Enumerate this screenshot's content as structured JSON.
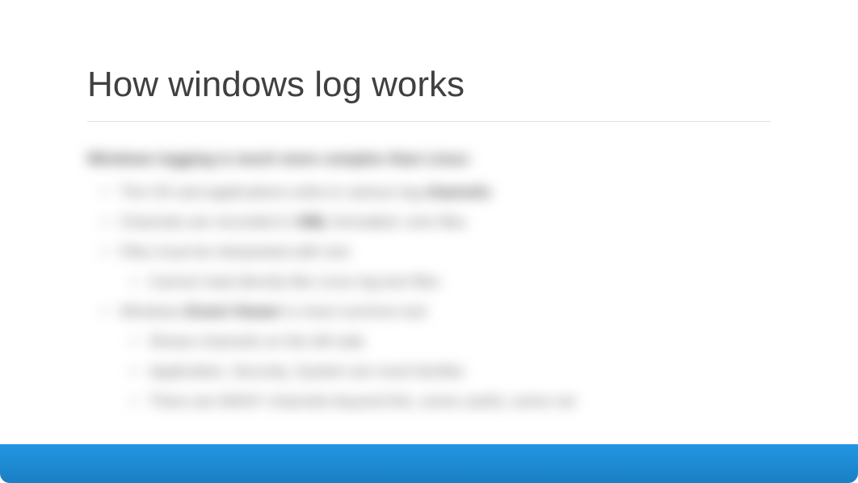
{
  "slide": {
    "title": "How windows log works",
    "intro": "Windows logging is much more complex than Linux:",
    "bullets": [
      {
        "text_prefix": "The OS and applications write to various log ",
        "bold": "channels",
        "text_suffix": ""
      },
      {
        "text_prefix": "Channels are recorded in ",
        "bold": "XML",
        "text_suffix": " formatted .evtx files"
      },
      {
        "text_prefix": "Files must be interpreted with tool",
        "bold": "",
        "text_suffix": "",
        "sub": [
          "Cannot read directly like Linux log text files"
        ]
      },
      {
        "text_prefix": "Windows ",
        "bold": "Event Viewer",
        "text_suffix": " is most common tool",
        "sub": [
          "Shows channels on the left side",
          "Application, Security, System are most familiar",
          "There are MANY channels beyond this, some useful, some not"
        ]
      }
    ]
  }
}
